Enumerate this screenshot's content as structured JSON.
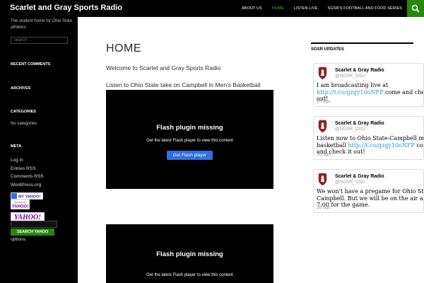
{
  "header": {
    "site_title": "Scarlet and Gray Sports Radio",
    "nav": [
      "ABOUT US",
      "HOME",
      "LISTEN LIVE",
      "SGSR'S FOOTBALL AND FOOD SERIES"
    ],
    "active_nav": "HOME"
  },
  "sidebar": {
    "tagline": "The student home for Ohio State athletics",
    "search_placeholder": "Search …",
    "recent_comments": "RECENT COMMENTS",
    "archives": "ARCHIVES",
    "categories": "CATEGORIES",
    "no_categories": "No categories",
    "meta": "META",
    "meta_links": [
      "Log in",
      "Entries RSS",
      "Comments RSS",
      "WordPress.org"
    ],
    "badges": [
      "MY YAHOO!",
      "HOSTED BY YAHOO!",
      "YAHOO!"
    ],
    "yahoo_search_button": "SEARCH YAHOO",
    "options": "options"
  },
  "main": {
    "title": "HOME",
    "intro": "Welcome to Scarlet and Gray Sports Radio",
    "listen": "Listen to Ohio State take on  Campbell in Men's Basketball",
    "flash_title": "Flash plugin missing",
    "flash_sub": "Get the latest Flash player to view this content",
    "flash_button": "Get Flash player"
  },
  "twitter": {
    "header": "SGSR UPDATES",
    "tweets": [
      {
        "name": "Scarlet & Gray Radio",
        "handle": "@SGSR_OSU",
        "line1": "I am broadcasting live at",
        "link": "http://t.co/gzgy10oNFP",
        "line2_after": "come and check it",
        "line3": "out!",
        "time": "6h ago"
      },
      {
        "name": "Scarlet & Gray Radio",
        "handle": "@SGSR_OSU",
        "line1": "Listen now to Ohio State-Campbell men's",
        "line2_before": "basketball ",
        "link": "http://t.co/gzgy10oNFP",
        "line2_after": "come",
        "line3": "and check it out!",
        "time": "2d ago"
      },
      {
        "name": "Scarlet & Gray Radio",
        "handle": "@SGSR_OSU",
        "line1": "We won't have a pregame for Ohio State-",
        "line2": "Campbell. But we will be on the air at",
        "line3": "7:00 for the game.",
        "time": "2d ago"
      }
    ]
  },
  "colors": {
    "accent": "#24890d",
    "link": "#2a95c9",
    "flash_button": "#2f6fdf"
  }
}
